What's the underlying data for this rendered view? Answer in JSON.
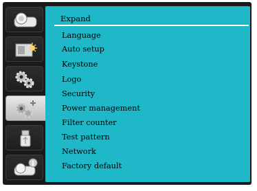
{
  "panel": {
    "title": "Expand",
    "items": [
      "Language",
      "Auto setup",
      "Keystone",
      "Logo",
      "Security",
      "Power management",
      "Filter counter",
      "Test pattern",
      "Network",
      "Factory default"
    ]
  },
  "sidebar": {
    "icons": [
      "projector-icon",
      "input-icon",
      "settings-icon",
      "expand-settings-icon",
      "usb-icon",
      "info-icon"
    ],
    "active_index": 3
  },
  "colors": {
    "panel_bg": "#1fb8c8",
    "frame_bg": "#1a1a1a",
    "active_tab": "#d9d9d9"
  }
}
